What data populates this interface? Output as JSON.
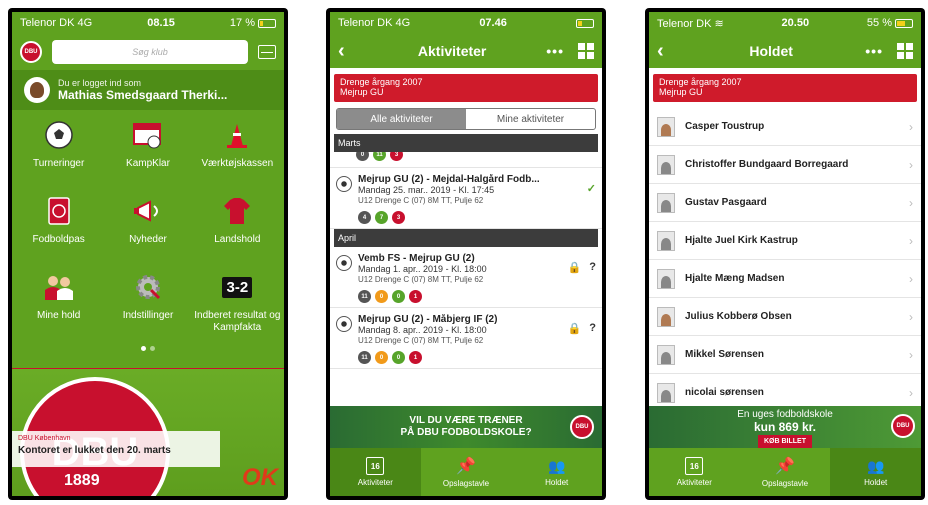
{
  "colors": {
    "brand_green": "#5fa21f",
    "brand_red": "#c8102e"
  },
  "phone1": {
    "status": {
      "carrier": "Telenor DK",
      "network": "4G",
      "time": "08.15",
      "battery": "17 %",
      "battery_level": 0.17
    },
    "search_placeholder": "Søg klub",
    "login": {
      "prefix": "Du er logget ind som",
      "name": "Mathias Smedsgaard Therki..."
    },
    "tiles": [
      {
        "label": "Turneringer",
        "icon": "soccer-ball-icon"
      },
      {
        "label": "KampKlar",
        "icon": "kampklar-icon"
      },
      {
        "label": "Værktøjskassen",
        "icon": "cone-icon"
      },
      {
        "label": "Fodboldpas",
        "icon": "passport-icon"
      },
      {
        "label": "Nyheder",
        "icon": "megaphone-icon"
      },
      {
        "label": "Landshold",
        "icon": "jersey-icon"
      },
      {
        "label": "Mine hold",
        "icon": "team-icon"
      },
      {
        "label": "Indstillinger",
        "icon": "gear-icon"
      },
      {
        "label": "Indberet resultat og Kampfakta",
        "icon": "scoreboard-icon",
        "score": "3-2"
      }
    ],
    "banner": {
      "club": "DBU København",
      "message": "Kontoret er lukket den 20. marts",
      "sponsor": "OK",
      "seal_text": "DBU",
      "seal_year": "1889"
    }
  },
  "phone2": {
    "status": {
      "carrier": "Telenor DK",
      "network": "4G",
      "time": "07.46"
    },
    "title": "Aktiviteter",
    "team": {
      "name": "Drenge årgang 2007",
      "club": "Mejrup GU"
    },
    "segments": [
      "Alle aktiviteter",
      "Mine aktiviteter"
    ],
    "months": [
      "Marts",
      "April"
    ],
    "partial_badges": [
      "0",
      "11",
      "3"
    ],
    "activities": [
      {
        "title": "Mejrup GU (2) - Mejdal-Halgård Fodb...",
        "date": "Mandag 25. mar.. 2019 - Kl. 17:45",
        "details": "U12 Drenge C (07) 8M TT, Pulje 62",
        "badges": [
          "4",
          "7",
          "3"
        ],
        "status": "✓"
      },
      {
        "title": "Vemb FS - Mejrup GU (2)",
        "date": "Mandag 1. apr.. 2019 - Kl. 18:00",
        "details": "U12 Drenge C (07) 8M TT, Pulje 62",
        "badges": [
          "11",
          "0",
          "0",
          "1"
        ],
        "status": "?"
      },
      {
        "title": "Mejrup GU (2) - Måbjerg IF (2)",
        "date": "Mandag 8. apr.. 2019 - Kl. 18:00",
        "details": "U12 Drenge C (07) 8M TT, Pulje 62",
        "badges": [
          "11",
          "0",
          "0",
          "1"
        ],
        "status": "?"
      }
    ],
    "ad": {
      "line1": "VIL DU VÆRE TRÆNER",
      "line2": "PÅ DBU FODBOLDSKOLE?"
    },
    "tabs": [
      {
        "label": "Aktiviteter",
        "day": "16"
      },
      {
        "label": "Opslagstavle"
      },
      {
        "label": "Holdet"
      }
    ]
  },
  "phone3": {
    "status": {
      "carrier": "Telenor DK",
      "time": "20.50",
      "battery": "55 %"
    },
    "title": "Holdet",
    "team": {
      "name": "Drenge årgang 2007",
      "club": "Mejrup GU"
    },
    "members": [
      "Casper Toustrup",
      "Christoffer Bundgaard Borregaard",
      "Gustav Pasgaard",
      "Hjalte Juel Kirk Kastrup",
      "Hjalte Mæng Madsen",
      "Julius Kobberø Obsen",
      "Mikkel Sørensen",
      "nicolai sørensen"
    ],
    "ad": {
      "line1": "En uges fodboldskole",
      "line2": "kun 869 kr.",
      "cta": "KØB BILLET"
    },
    "tabs": [
      {
        "label": "Aktiviteter",
        "day": "16"
      },
      {
        "label": "Opslagstavle"
      },
      {
        "label": "Holdet"
      }
    ]
  }
}
